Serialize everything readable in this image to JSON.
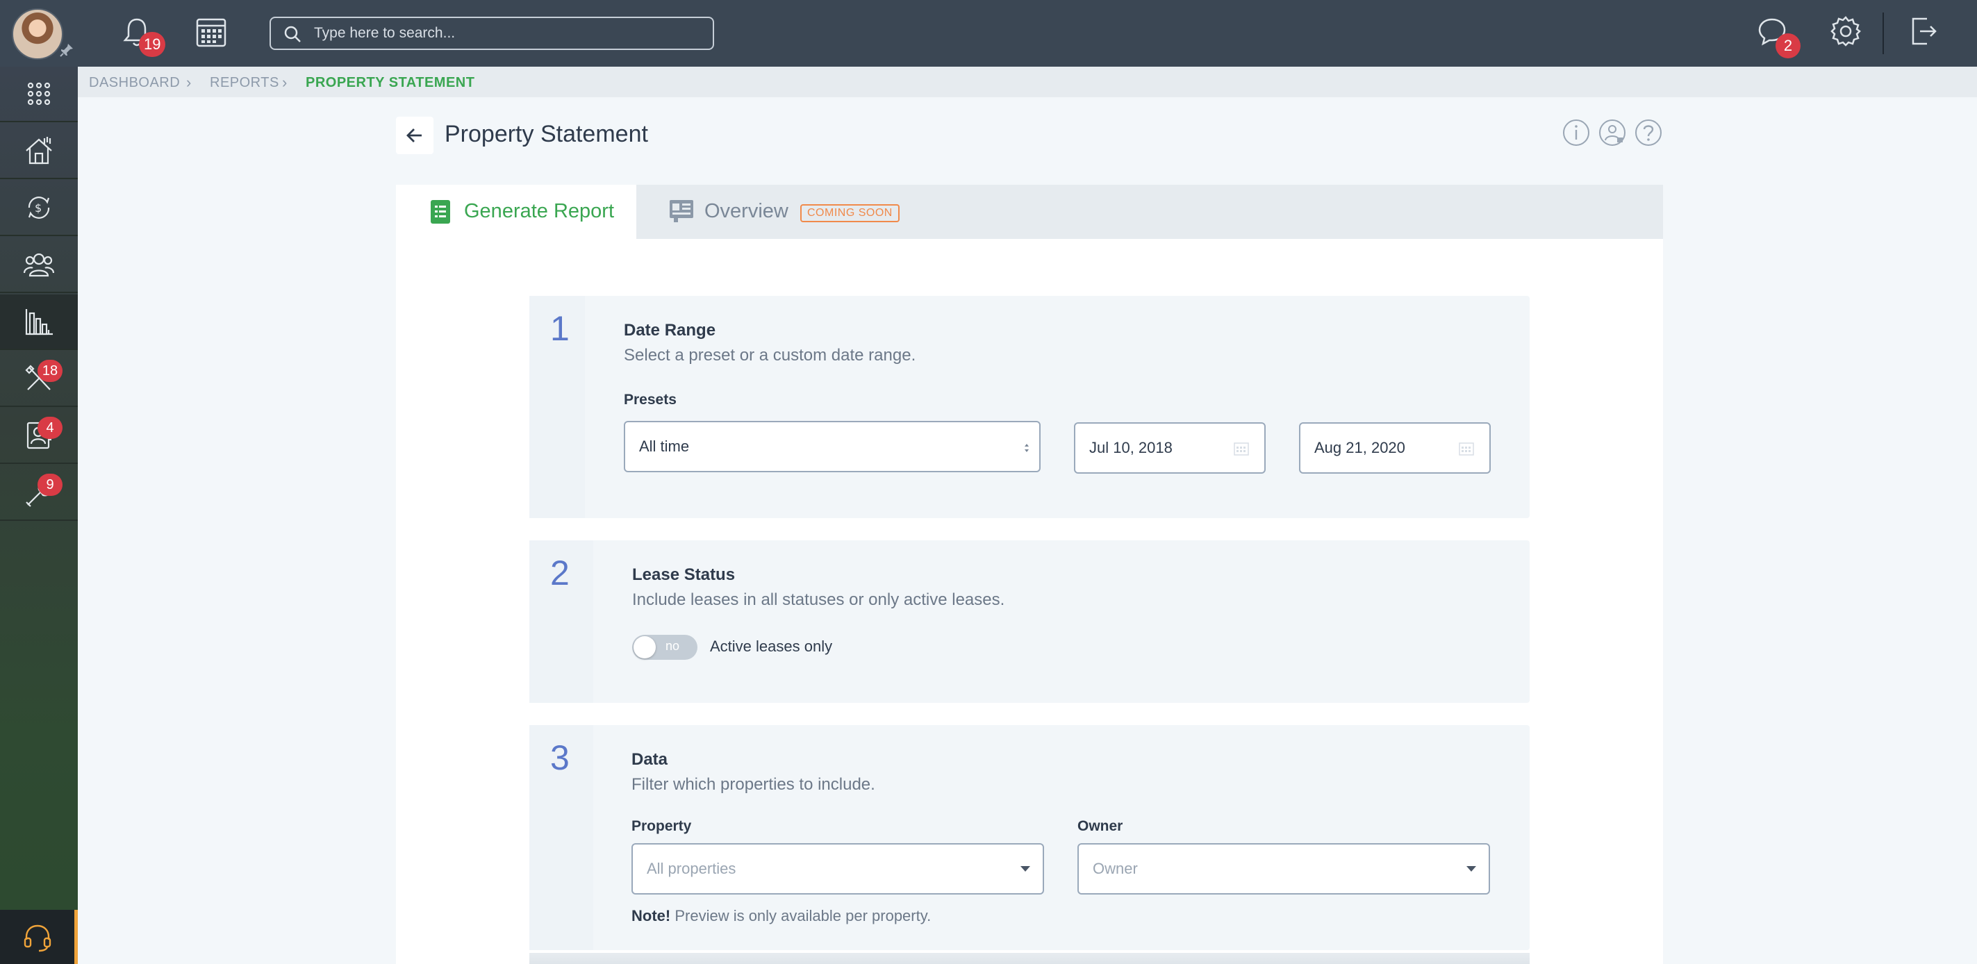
{
  "topbar": {
    "notifications_count": "19",
    "messages_count": "2",
    "search_placeholder": "Type here to search..."
  },
  "sidebar": {
    "items": [
      {
        "name": "apps",
        "icon": "grid-icon",
        "badge": ""
      },
      {
        "name": "properties",
        "icon": "house-icon",
        "badge": ""
      },
      {
        "name": "accounting",
        "icon": "money-cycle-icon",
        "badge": ""
      },
      {
        "name": "people",
        "icon": "people-icon",
        "badge": ""
      },
      {
        "name": "reports",
        "icon": "chart-icon",
        "badge": "",
        "active": true
      },
      {
        "name": "maintenance",
        "icon": "tools-icon",
        "badge": "18"
      },
      {
        "name": "applicants",
        "icon": "contact-icon",
        "badge": "4"
      },
      {
        "name": "tasks",
        "icon": "wrench-icon",
        "badge": "9"
      }
    ]
  },
  "breadcrumb": {
    "items": [
      "DASHBOARD",
      "REPORTS",
      "PROPERTY STATEMENT"
    ]
  },
  "page": {
    "title": "Property Statement"
  },
  "tabs": {
    "generate": "Generate Report",
    "overview": "Overview",
    "coming_soon": "COMING SOON"
  },
  "step1": {
    "number": "1",
    "title": "Date Range",
    "description": "Select a preset or a custom date range.",
    "presets_label": "Presets",
    "preset_value": "All time",
    "start_date": "Jul 10, 2018",
    "end_date": "Aug 21, 2020"
  },
  "step2": {
    "number": "2",
    "title": "Lease Status",
    "description": "Include leases in all statuses or only active leases.",
    "toggle_state": "no",
    "toggle_label": "Active leases only"
  },
  "step3": {
    "number": "3",
    "title": "Data",
    "description": "Filter which properties to include.",
    "property_label": "Property",
    "property_placeholder": "All properties",
    "owner_label": "Owner",
    "owner_placeholder": "Owner",
    "note_strong": "Note!",
    "note_text": " Preview is only available per property."
  },
  "colors": {
    "accent_green": "#3aa651",
    "step_blue": "#5b78c9",
    "badge_red": "#d93b45",
    "coming_soon_orange": "#f08a4b"
  }
}
